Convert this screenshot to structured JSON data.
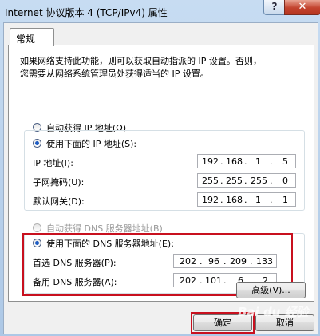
{
  "window": {
    "title": "Internet 协议版本 4 (TCP/IPv4) 属性",
    "help_label": "?",
    "close_label": "✕"
  },
  "tab": {
    "label": "常规"
  },
  "description": {
    "line1": "如果网络支持此功能，则可以获取自动指派的 IP 设置。否则，",
    "line2": "您需要从网络系统管理员处获得适当的 IP 设置。"
  },
  "ip": {
    "auto_label": "自动获得 IP 地址(O)",
    "manual_label": "使用下面的 IP 地址(S):",
    "fields": [
      {
        "label": "IP 地址(I):",
        "octets": [
          "192",
          "168",
          "1",
          "5"
        ]
      },
      {
        "label": "子网掩码(U):",
        "octets": [
          "255",
          "255",
          "255",
          "0"
        ]
      },
      {
        "label": "默认网关(D):",
        "octets": [
          "192",
          "168",
          "1",
          "1"
        ]
      }
    ]
  },
  "dns": {
    "auto_label": "自动获得 DNS 服务器地址(B)",
    "manual_label": "使用下面的 DNS 服务器地址(E):",
    "fields": [
      {
        "label": "首选 DNS 服务器(P):",
        "octets": [
          "202",
          "96",
          "209",
          "133"
        ]
      },
      {
        "label": "备用 DNS 服务器(A):",
        "octets": [
          "202",
          "101",
          "6",
          "2"
        ]
      }
    ]
  },
  "buttons": {
    "advanced": "高级(V)...",
    "ok": "确定",
    "cancel": "取消"
  },
  "watermark": {
    "text": "Bai du 经验"
  },
  "colors": {
    "highlight_box": "#c8101e",
    "radio_dot": "#1d5cc4"
  }
}
